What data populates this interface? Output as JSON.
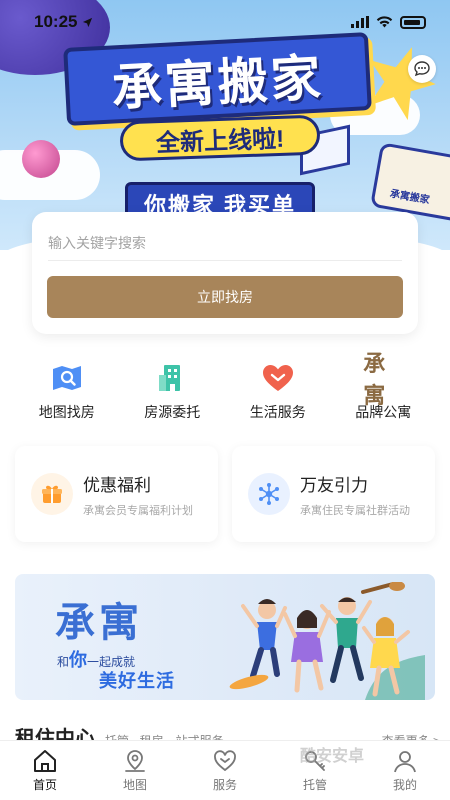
{
  "status_bar": {
    "time": "10:25"
  },
  "banner": {
    "title": "承寓搬家",
    "subtitle": "全新上线啦!",
    "slogan": "你搬家 我买单",
    "bus_label": "承寓搬家"
  },
  "search": {
    "placeholder": "输入关键字搜索",
    "button_label": "立即找房"
  },
  "quick_nav": [
    {
      "label": "地图找房",
      "icon": "map-search-icon"
    },
    {
      "label": "房源委托",
      "icon": "building-icon"
    },
    {
      "label": "生活服务",
      "icon": "heart-icon"
    },
    {
      "label": "品牌公寓",
      "icon": "brand-logo-icon",
      "glyph": "承寓"
    }
  ],
  "features": [
    {
      "title": "优惠福利",
      "subtitle": "承寓会员专属福利计划",
      "icon": "gift-icon"
    },
    {
      "title": "万友引力",
      "subtitle": "承寓住民专属社群活动",
      "icon": "network-icon"
    }
  ],
  "promo": {
    "brand": "承寓",
    "line_prefix": "和",
    "line_emph": "你",
    "line_suffix": "一起成就",
    "line2": "美好生活"
  },
  "section": {
    "title": "租住中心",
    "tag": "托管 · 租房一站式服务",
    "more": "查看更多 >"
  },
  "tabbar": [
    {
      "label": "首页",
      "icon": "home-icon",
      "active": true
    },
    {
      "label": "地图",
      "icon": "map-pin-icon",
      "active": false
    },
    {
      "label": "服务",
      "icon": "heart-outline-icon",
      "active": false
    },
    {
      "label": "托管",
      "icon": "key-icon",
      "active": false
    },
    {
      "label": "我的",
      "icon": "user-icon",
      "active": false
    }
  ],
  "watermark": "酷安安卓",
  "colors": {
    "accent": "#a8855a",
    "brand_blue": "#3a6fd3",
    "heart_red": "#f0624d",
    "building_teal": "#3ec3a8"
  }
}
